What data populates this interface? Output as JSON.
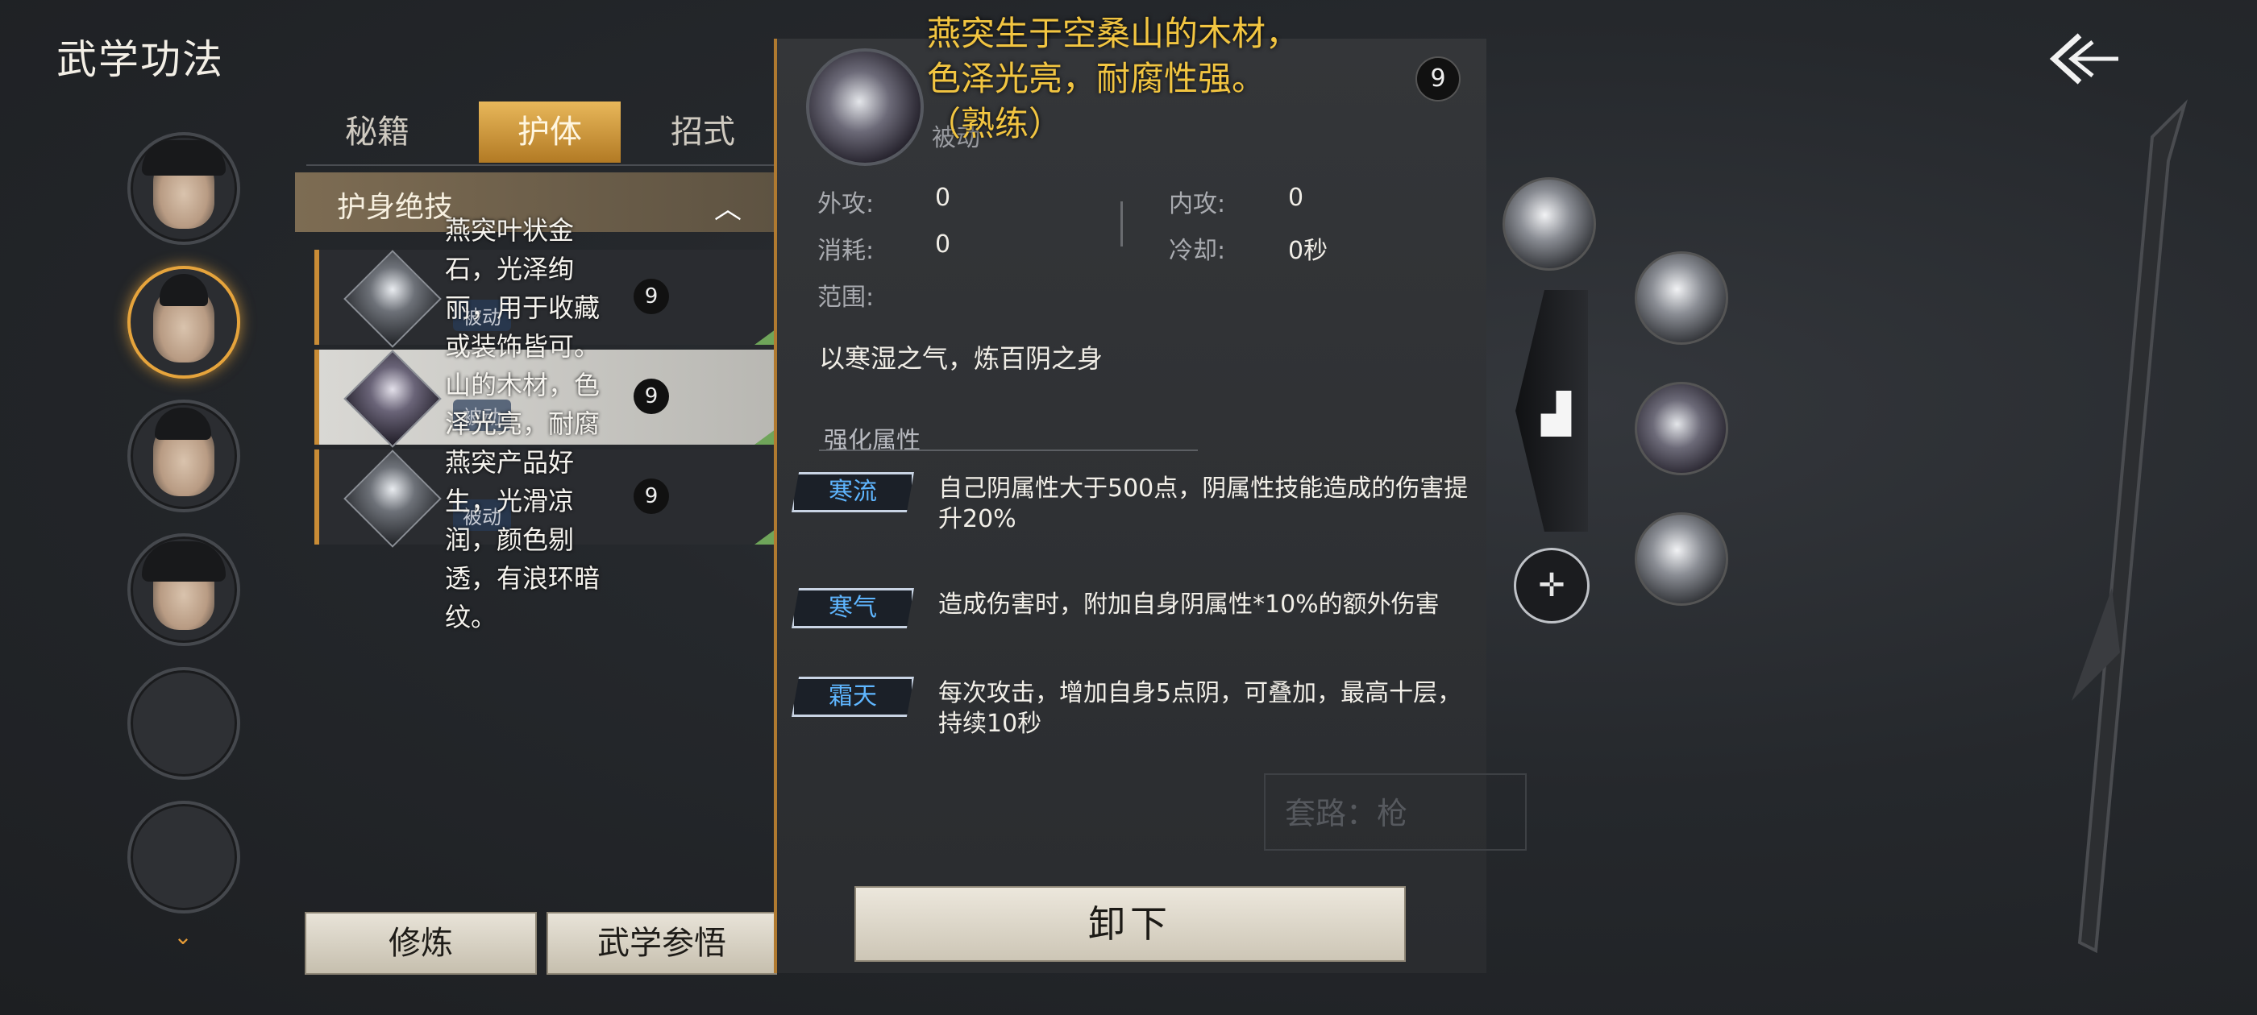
{
  "page_title": "武学功法",
  "tabs": [
    "秘籍",
    "护体",
    "招式"
  ],
  "active_tab": "护体",
  "section": {
    "label": "护身绝技"
  },
  "skills": [
    {
      "tag": "被动",
      "coin": "9"
    },
    {
      "tag": "被动",
      "coin": "9"
    },
    {
      "tag": "被动",
      "coin": "9"
    }
  ],
  "overlay_text": "燕突叶状金石，光泽绚丽，用于收藏或装饰皆可。山的木材，色泽光亮，耐腐燕突产品好生，光滑凉润，颜色剔透，有浪环暗纹。",
  "bottom_buttons": {
    "train": "修炼",
    "insight": "武学参悟"
  },
  "detail": {
    "float_desc": "燕突生于空桑山的木材，色泽光亮，耐腐性强。（熟练）",
    "tag": "被动",
    "coin": "9",
    "stats": {
      "outer_attack_label": "外攻:",
      "outer_attack": "0",
      "inner_attack_label": "内攻:",
      "inner_attack": "0",
      "cost_label": "消耗:",
      "cost": "0",
      "cooldown_label": "冷却:",
      "cooldown": "0秒",
      "range_label": "范围:"
    },
    "description": "以寒湿之气，炼百阴之身",
    "enhance_title": "强化属性",
    "enhancements": [
      {
        "name": "寒流",
        "text": "自己阴属性大于500点，阴属性技能造成的伤害提升20%"
      },
      {
        "name": "寒气",
        "text": "造成伤害时，附加自身阴属性*10%的额外伤害"
      },
      {
        "name": "霜天",
        "text": "每次攻击，增加自身5点阴，可叠加，最高十层，持续10秒"
      }
    ],
    "unequip_label": "卸下"
  },
  "set_route": "套路：枪",
  "colors": {
    "accent": "#e6a43c",
    "badge_text": "#5fb6ff",
    "desc_gold": "#f2c541"
  }
}
